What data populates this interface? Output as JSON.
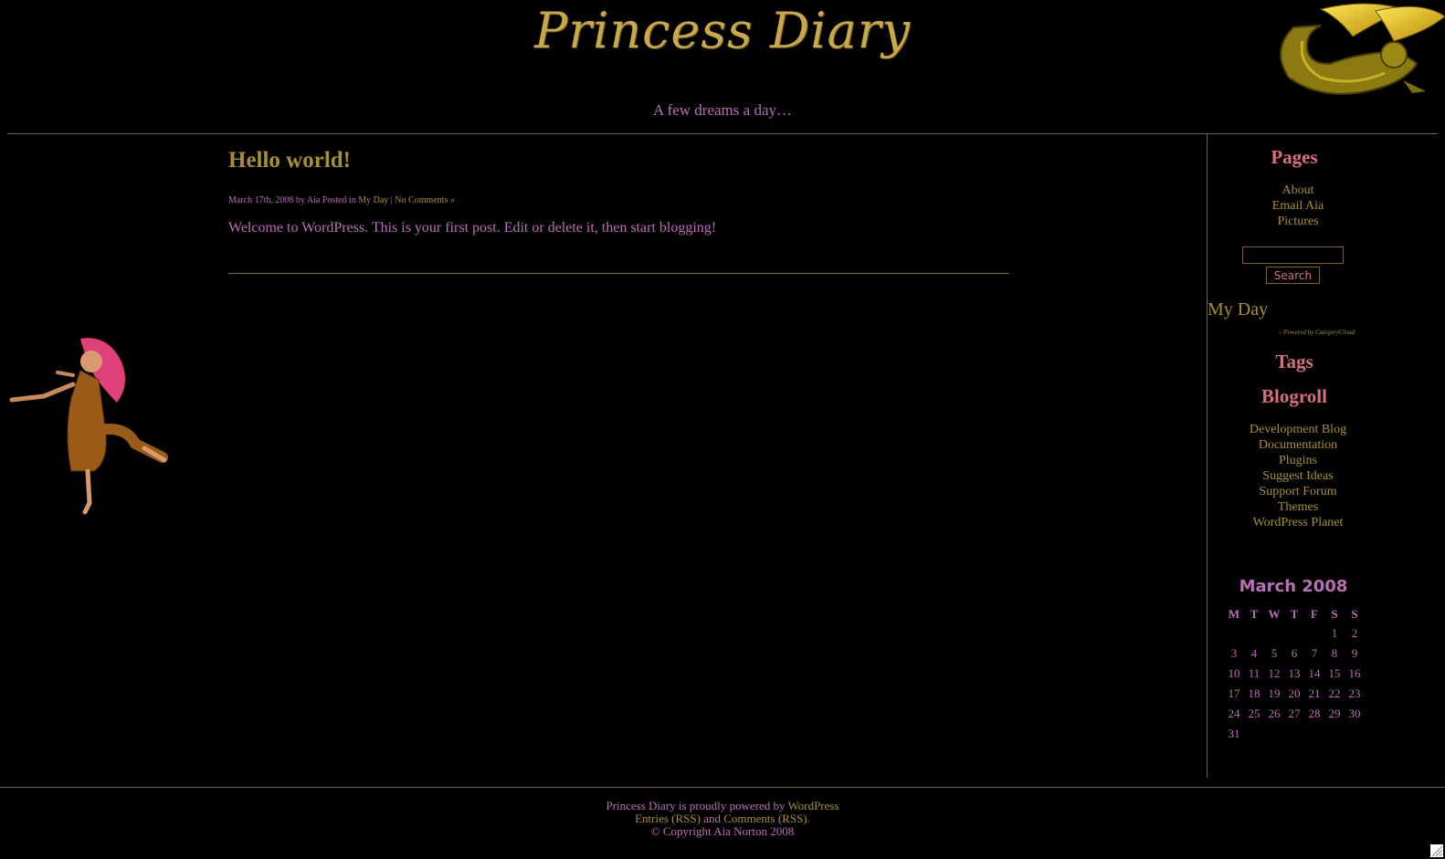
{
  "header": {
    "site_title": "Princess Diary",
    "tagline": "A few dreams a day…"
  },
  "post": {
    "title": "Hello world!",
    "meta": {
      "date_author": "March 17th, 2008 by Aia Posted in ",
      "category": "My Day",
      "separator": " | ",
      "comments": "No Comments »"
    },
    "body": "Welcome to WordPress. This is your first post. Edit or delete it, then start blogging!"
  },
  "sidebar": {
    "pages_heading": "Pages",
    "pages": [
      "About",
      "Email Aia",
      "Pictures"
    ],
    "search_button": "Search",
    "search_value": "",
    "category_cloud": {
      "items": [
        "My Day"
      ],
      "powered_by": "– Powered by CategoryCloud"
    },
    "tags_heading": "Tags",
    "blogroll_heading": "Blogroll",
    "blogroll": [
      "Development Blog",
      "Documentation",
      "Plugins",
      "Suggest Ideas",
      "Support Forum",
      "Themes",
      "WordPress Planet"
    ],
    "calendar": {
      "caption": "March 2008",
      "weekdays": [
        "M",
        "T",
        "W",
        "T",
        "F",
        "S",
        "S"
      ],
      "weeks": [
        [
          "",
          "",
          "",
          "",
          "",
          "1",
          "2"
        ],
        [
          "3",
          "4",
          "5",
          "6",
          "7",
          "8",
          "9"
        ],
        [
          "10",
          "11",
          "12",
          "13",
          "14",
          "15",
          "16"
        ],
        [
          "17",
          "18",
          "19",
          "20",
          "21",
          "22",
          "23"
        ],
        [
          "24",
          "25",
          "26",
          "27",
          "28",
          "29",
          "30"
        ],
        [
          "31",
          "",
          "",
          "",
          "",
          "",
          ""
        ]
      ],
      "linked_day": "17"
    }
  },
  "footer": {
    "line1_prefix": "Princess Diary is proudly powered by ",
    "wordpress_link": "WordPress",
    "entries_rss": "Entries (RSS)",
    "and": " and ",
    "comments_rss": "Comments (RSS)",
    "period": ".",
    "copyright": "© Copyright Aia Norton 2008"
  },
  "colors": {
    "background": "#000000",
    "gold": "#a8902e",
    "pink": "#b86fb6",
    "rose": "#d6707a",
    "rule": "#7a6422"
  }
}
